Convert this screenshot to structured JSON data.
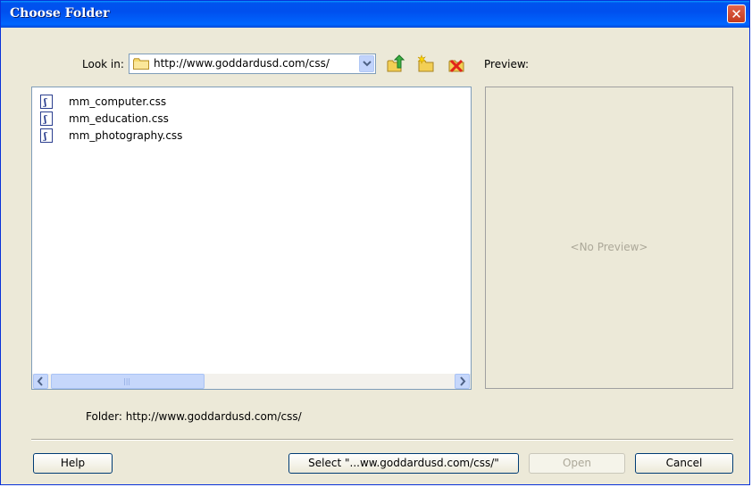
{
  "window": {
    "title": "Choose Folder"
  },
  "lookin": {
    "label": "Look in:",
    "value": "http://www.goddardusd.com/css/"
  },
  "preview": {
    "label": "Preview:",
    "placeholder": "<No Preview>"
  },
  "files": [
    {
      "name": "mm_computer.css"
    },
    {
      "name": "mm_education.css"
    },
    {
      "name": "mm_photography.css"
    }
  ],
  "folder": {
    "label": "Folder:",
    "value": "http://www.goddardusd.com/css/"
  },
  "buttons": {
    "help": "Help",
    "select": "Select \"...ww.goddardusd.com/css/\"",
    "open": "Open",
    "cancel": "Cancel"
  },
  "icons": {
    "close": "close-icon",
    "up": "up-one-level-icon",
    "new_folder": "new-folder-icon",
    "delete": "delete-icon",
    "file": "css-file-icon"
  }
}
